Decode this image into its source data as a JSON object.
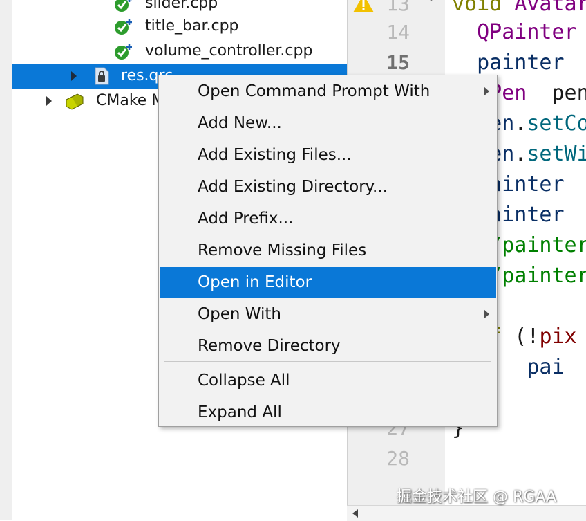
{
  "tree": {
    "files": [
      {
        "name": "slider.cpp"
      },
      {
        "name": "title_bar.cpp"
      },
      {
        "name": "volume_controller.cpp"
      }
    ],
    "selected_resource": "res.qrc",
    "cmake_node": "CMake Modules"
  },
  "editor": {
    "line_numbers": [
      "13",
      "14",
      "15",
      "27",
      "28"
    ],
    "lines": [
      {
        "parts": [
          [
            "kw",
            "void "
          ],
          [
            "ty",
            "AvatarW"
          ]
        ]
      },
      {
        "parts": [
          [
            "ty",
            "  QPainter"
          ]
        ]
      },
      {
        "parts": [
          [
            "vr",
            "  painter"
          ]
        ]
      },
      {
        "parts": [
          [
            "ty",
            "  QPen"
          ],
          [
            "",
            "  pen;"
          ]
        ]
      },
      {
        "parts": [
          [
            "vr",
            "  pen"
          ],
          [
            "",
            "."
          ],
          [
            "fn",
            "setCol"
          ]
        ]
      },
      {
        "parts": [
          [
            "vr",
            "  pen"
          ],
          [
            "",
            "."
          ],
          [
            "fn",
            "setWid"
          ]
        ]
      },
      {
        "parts": [
          [
            "vr",
            "  painter"
          ]
        ]
      },
      {
        "parts": [
          [
            "vr",
            "  painter"
          ]
        ]
      },
      {
        "parts": [
          [
            "cm",
            "  //painter"
          ]
        ]
      },
      {
        "parts": [
          [
            "cm",
            "  //painter"
          ]
        ]
      },
      {
        "parts": [
          [
            "",
            ""
          ]
        ]
      },
      {
        "parts": [
          [
            "kw",
            "  if"
          ],
          [
            "",
            " (!"
          ],
          [
            "dr",
            "pix"
          ]
        ]
      },
      {
        "parts": [
          [
            "vr",
            "      pai"
          ]
        ]
      },
      {
        "parts": [
          [
            "",
            "  }"
          ]
        ]
      },
      {
        "parts": [
          [
            "",
            "}"
          ]
        ]
      }
    ]
  },
  "context_menu": {
    "items": [
      {
        "label": "Open Command Prompt With",
        "submenu": true
      },
      {
        "label": "Add New...",
        "submenu": false
      },
      {
        "label": "Add Existing Files...",
        "submenu": false
      },
      {
        "label": "Add Existing Directory...",
        "submenu": false
      },
      {
        "label": "Add Prefix...",
        "submenu": false
      },
      {
        "label": "Remove Missing Files",
        "submenu": false
      },
      {
        "label": "Open in Editor",
        "submenu": false,
        "active": true
      },
      {
        "label": "Open With",
        "submenu": true
      },
      {
        "label": "Remove Directory",
        "submenu": false
      },
      {
        "label": "Collapse All",
        "submenu": false
      },
      {
        "label": "Expand All",
        "submenu": false
      }
    ]
  },
  "watermark": "掘金技术社区 @ RGAA",
  "colors": {
    "selection": "#0a78d7",
    "menu_bg": "#f2f2f2",
    "gutter_bg": "#efefef",
    "warning": "#f2c100"
  }
}
